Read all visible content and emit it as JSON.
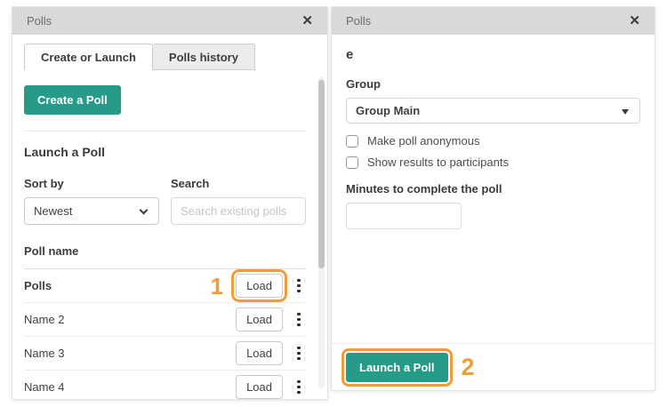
{
  "colors": {
    "teal": "#279b8a",
    "orange": "#f09c38",
    "header_bg": "#d9d9d9"
  },
  "left_panel": {
    "title": "Polls",
    "close_glyph": "✕",
    "tabs": [
      {
        "label": "Create or Launch",
        "active": true
      },
      {
        "label": "Polls history",
        "active": false
      }
    ],
    "create_button": "Create a Poll",
    "section_title": "Launch a Poll",
    "sort": {
      "label": "Sort by",
      "value": "Newest"
    },
    "search": {
      "label": "Search",
      "placeholder": "Search existing polls"
    },
    "list_header": "Poll name",
    "load_label": "Load",
    "rows": [
      {
        "name": "Polls",
        "annotation": "1",
        "highlighted": true
      },
      {
        "name": "Name 2"
      },
      {
        "name": "Name 3"
      },
      {
        "name": "Name 4"
      }
    ]
  },
  "right_panel": {
    "title": "Polls",
    "close_glyph": "✕",
    "poll_name": "e",
    "group": {
      "label": "Group",
      "value": "Group Main"
    },
    "checkboxes": [
      {
        "label": "Make poll anonymous",
        "checked": false
      },
      {
        "label": "Show results to participants",
        "checked": false
      }
    ],
    "minutes_label": "Minutes to complete the poll",
    "minutes_value": "",
    "launch_button": "Launch a Poll",
    "annotation": "2"
  }
}
